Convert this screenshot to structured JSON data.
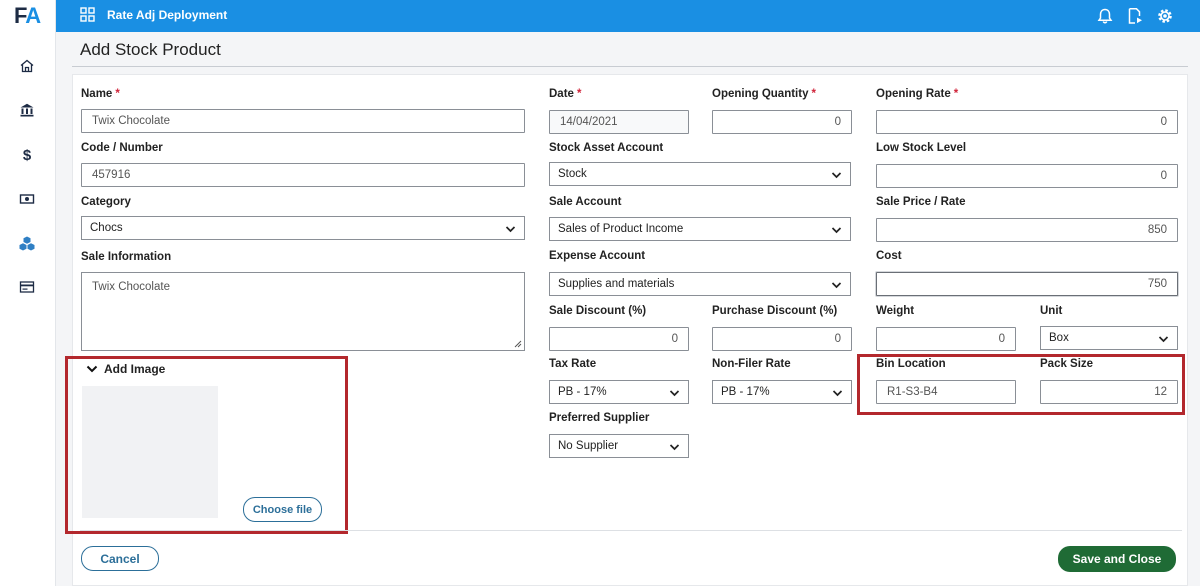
{
  "app": {
    "logo_f": "F",
    "logo_a": "A",
    "title": "Rate Adj Deployment"
  },
  "sidebar": {
    "icons": [
      "home-icon",
      "bank-icon",
      "dollar-icon",
      "cash-icon",
      "cubes-icon",
      "card-icon"
    ]
  },
  "topbar": {
    "icons": [
      "bell-icon",
      "document-play-icon",
      "gear-icon"
    ]
  },
  "page": {
    "title": "Add Stock Product"
  },
  "form": {
    "name": {
      "label": "Name",
      "required": "*",
      "value": "Twix Chocolate"
    },
    "code": {
      "label": "Code / Number",
      "value": "457916"
    },
    "category": {
      "label": "Category",
      "value": "Chocs"
    },
    "sale_info": {
      "label": "Sale Information",
      "value": "Twix Chocolate"
    },
    "date": {
      "label": "Date",
      "required": "*",
      "value": "14/04/2021"
    },
    "opening_qty": {
      "label": "Opening Quantity",
      "required": "*",
      "value": "0"
    },
    "opening_rate": {
      "label": "Opening Rate",
      "required": "*",
      "value": "0"
    },
    "stock_asset": {
      "label": "Stock Asset Account",
      "value": "Stock"
    },
    "low_stock": {
      "label": "Low Stock Level",
      "value": "0"
    },
    "sale_account": {
      "label": "Sale Account",
      "value": "Sales of Product Income"
    },
    "sale_price": {
      "label": "Sale Price / Rate",
      "value": "850"
    },
    "expense_account": {
      "label": "Expense Account",
      "value": "Supplies and materials"
    },
    "cost": {
      "label": "Cost",
      "value": "750"
    },
    "sale_discount": {
      "label": "Sale Discount (%)",
      "value": "0"
    },
    "purchase_discount": {
      "label": "Purchase Discount (%)",
      "value": "0"
    },
    "weight": {
      "label": "Weight",
      "value": "0"
    },
    "unit": {
      "label": "Unit",
      "value": "Box"
    },
    "tax_rate": {
      "label": "Tax Rate",
      "value": "PB - 17%"
    },
    "non_filer": {
      "label": "Non-Filer Rate",
      "value": "PB - 17%"
    },
    "bin_location": {
      "label": "Bin Location",
      "value": "R1-S3-B4"
    },
    "pack_size": {
      "label": "Pack Size",
      "value": "12"
    },
    "preferred_supplier": {
      "label": "Preferred Supplier",
      "value": "No Supplier"
    }
  },
  "image": {
    "toggle_label": "Add Image",
    "choose_label": "Choose file"
  },
  "actions": {
    "cancel": "Cancel",
    "save": "Save and Close"
  },
  "colors": {
    "accent": "#1a8fe3",
    "save": "#1f6b35",
    "highlight": "#b3282d",
    "required": "#d0243a"
  }
}
